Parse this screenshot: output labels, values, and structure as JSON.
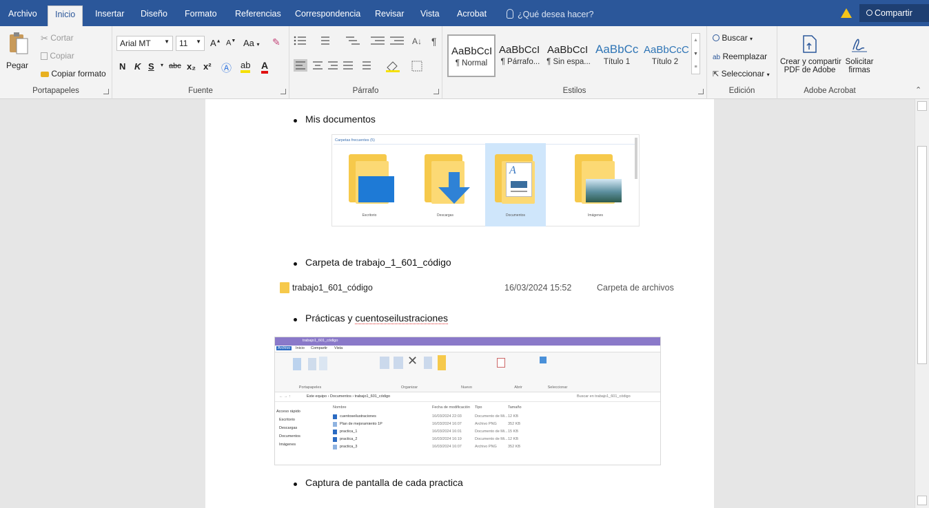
{
  "tabs": [
    "Archivo",
    "Inicio",
    "Insertar",
    "Diseño",
    "Formato",
    "Referencias",
    "Correspondencia",
    "Revisar",
    "Vista",
    "Acrobat"
  ],
  "tell_me": "¿Qué desea hacer?",
  "share": "Compartir",
  "clipboard": {
    "paste": "Pegar",
    "cut": "Cortar",
    "copy": "Copiar",
    "format_painter": "Copiar formato",
    "label": "Portapapeles"
  },
  "font": {
    "name": "Arial MT",
    "size": "11",
    "case": "Aa",
    "bold": "N",
    "italic": "K",
    "underline": "S",
    "strike": "abc",
    "sub": "x₂",
    "sup": "x²",
    "label": "Fuente"
  },
  "paragraph": {
    "label": "Párrafo"
  },
  "styles": {
    "items": [
      {
        "preview": "AaBbCcI",
        "name": "¶ Normal"
      },
      {
        "preview": "AaBbCcI",
        "name": "¶ Párrafo..."
      },
      {
        "preview": "AaBbCcI",
        "name": "¶ Sin espa..."
      },
      {
        "preview": "AaBbCc",
        "name": "Título 1"
      },
      {
        "preview": "AaBbCcC",
        "name": "Título 2"
      }
    ],
    "label": "Estilos"
  },
  "editing": {
    "find": "Buscar",
    "replace": "Reemplazar",
    "select": "Seleccionar",
    "label": "Edición"
  },
  "acrobat": {
    "create_l1": "Crear y compartir",
    "create_l2": "PDF de Adobe",
    "sign_l1": "Solicitar",
    "sign_l2": "firmas",
    "label": "Adobe Acrobat"
  },
  "document": {
    "bullet1": "Mis documentos",
    "pic1": {
      "header": "Carpetas frecuentes (5)",
      "folders": [
        "Escritorio",
        "Descargas",
        "Documentos",
        "Imágenes"
      ]
    },
    "bullet2": "Carpeta de trabajo_1_601_código",
    "folder_row": {
      "name": "trabajo1_601_código",
      "date": "16/03/2024 15:52",
      "type": "Carpeta de archivos"
    },
    "bullet3_a": "Prácticas y ",
    "bullet3_b": "cuentoseilustraciones",
    "pic2": {
      "title": "trabajo1_601_código",
      "tabs": [
        "Archivo",
        "Inicio",
        "Compartir",
        "Vista"
      ],
      "path": "Este equipo › Documentos › trabajo1_601_código",
      "search": "Buscar en trabajo1_601_código",
      "headers": [
        "Nombre",
        "Fecha de modificación",
        "Tipo",
        "Tamaño"
      ],
      "nav": [
        "Acceso rápido",
        "Escritorio",
        "Descargas",
        "Documentos",
        "Imágenes"
      ],
      "rows": [
        [
          "cuentoseilustraciones",
          "16/03/2024 22:03",
          "Documento de Mi...",
          "12 KB"
        ],
        [
          "Plan de mejoramiento 1P",
          "16/03/2024 16:07",
          "Archivo PNG",
          "352 KB"
        ],
        [
          "practica_1",
          "16/03/2024 16:01",
          "Documento de Mi...",
          "15 KB"
        ],
        [
          "practica_2",
          "16/03/2024 16:19",
          "Documento de Mi...",
          "12 KB"
        ],
        [
          "practica_3",
          "16/03/2024 16:07",
          "Archivo PNG",
          "352 KB"
        ]
      ],
      "groups": [
        "Portapapeles",
        "Organizar",
        "Nuevo",
        "Abrir",
        "Seleccionar"
      ]
    },
    "bullet4": "Captura de pantalla de cada practica"
  }
}
